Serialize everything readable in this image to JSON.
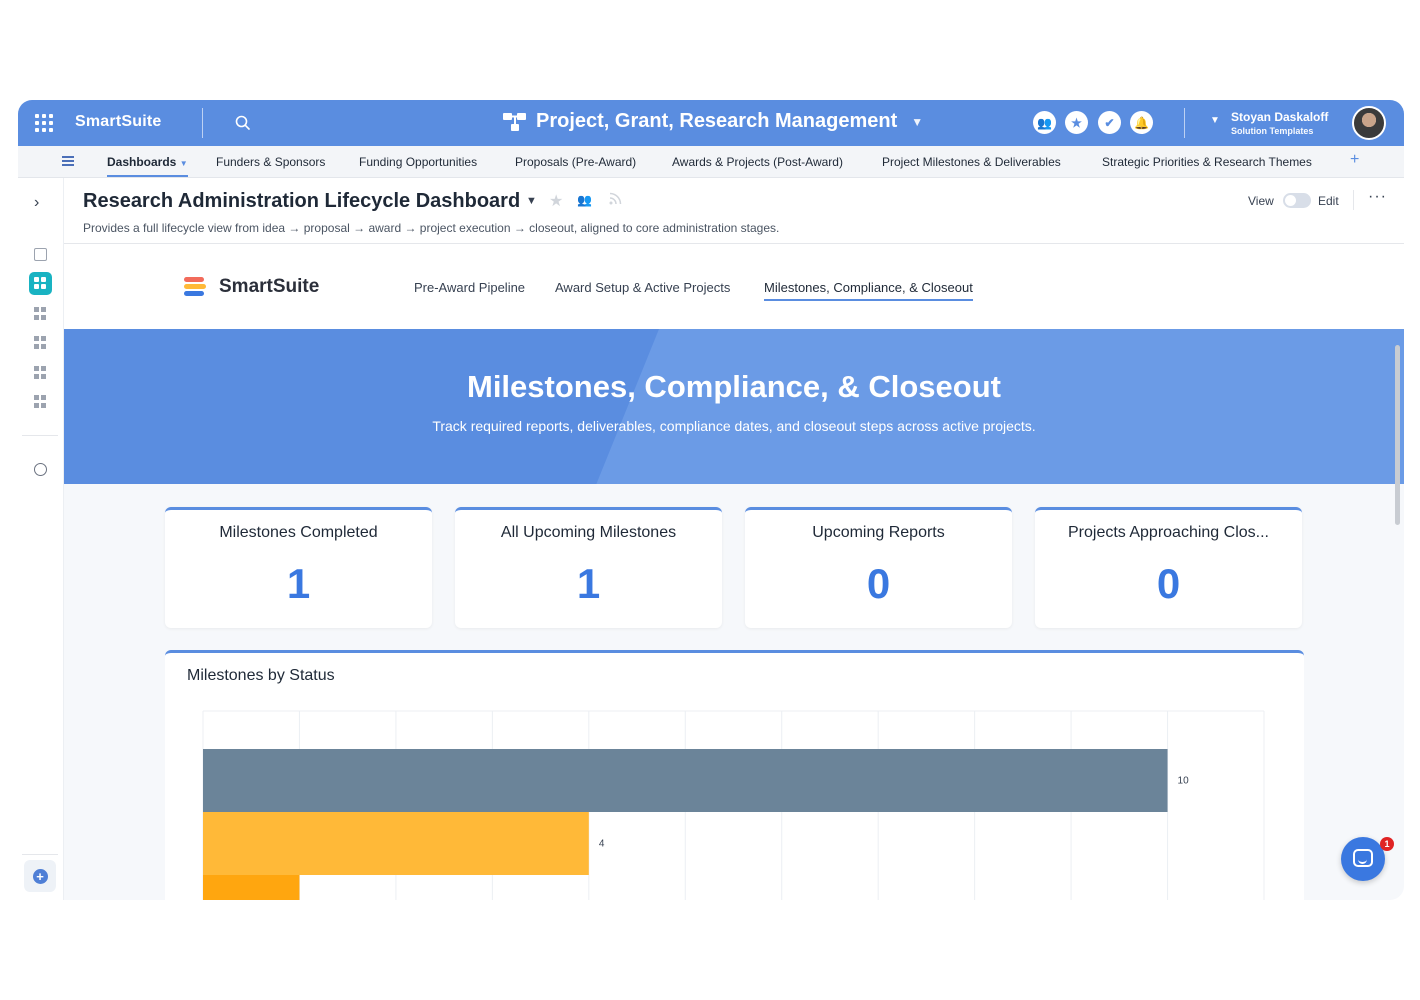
{
  "topbar": {
    "brand": "SmartSuite",
    "workspace_title": "Project, Grant, Research Management",
    "user_name": "Stoyan Daskaloff",
    "user_subtitle": "Solution Templates"
  },
  "nav": {
    "tabs": [
      {
        "label": "Dashboards",
        "active": true
      },
      {
        "label": "Funders & Sponsors"
      },
      {
        "label": "Funding Opportunities"
      },
      {
        "label": "Proposals (Pre-Award)"
      },
      {
        "label": "Awards & Projects (Post-Award)"
      },
      {
        "label": "Project Milestones & Deliverables"
      },
      {
        "label": "Strategic Priorities & Research Themes"
      }
    ],
    "add": "+"
  },
  "page": {
    "title": "Research Administration Lifecycle Dashboard",
    "description": "Provides a full lifecycle view from idea → proposal → award → project execution → closeout, aligned to core administration stages.",
    "view_label": "View",
    "edit_label": "Edit"
  },
  "dashboard": {
    "brand": "SmartSuite",
    "tabs": [
      {
        "label": "Pre-Award Pipeline"
      },
      {
        "label": "Award Setup & Active Projects"
      },
      {
        "label": "Milestones, Compliance, & Closeout",
        "active": true
      }
    ],
    "hero_title": "Milestones, Compliance, & Closeout",
    "hero_subtitle": "Track required reports, deliverables, compliance dates, and closeout steps across active projects.",
    "kpis": [
      {
        "label": "Milestones Completed",
        "value": "1"
      },
      {
        "label": "All Upcoming Milestones",
        "value": "1"
      },
      {
        "label": "Upcoming Reports",
        "value": "0"
      },
      {
        "label": "Projects Approaching Clos...",
        "value": "0"
      }
    ]
  },
  "chat_badge": "1",
  "colors": {
    "accent": "#5a8de0",
    "kpi_value": "#3a78e0",
    "bar_slate": "#6b8499",
    "bar_amber": "#ffb938",
    "bar_orange": "#ffa60f"
  },
  "chart_data": {
    "type": "bar",
    "orientation": "horizontal",
    "title": "Milestones by Status",
    "xlim": [
      0,
      11
    ],
    "categories": [
      "",
      "",
      ""
    ],
    "values": [
      10,
      4,
      1
    ],
    "data_labels": [
      "10",
      "4",
      ""
    ],
    "bar_colors": [
      "#6b8499",
      "#ffb938",
      "#ffa60f"
    ],
    "grid": true
  }
}
